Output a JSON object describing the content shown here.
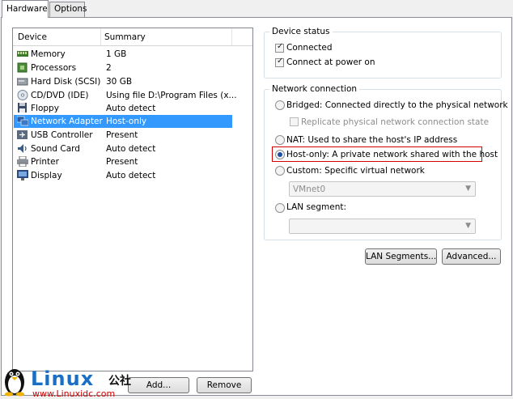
{
  "tabs": [
    {
      "label": "Hardware",
      "active": true
    },
    {
      "label": "Options",
      "active": false
    }
  ],
  "device_list": {
    "columns": [
      "Device",
      "Summary"
    ],
    "rows": [
      {
        "device": "Memory",
        "summary": "1 GB",
        "icon": "memory-icon"
      },
      {
        "device": "Processors",
        "summary": "2",
        "icon": "processor-icon"
      },
      {
        "device": "Hard Disk (SCSI)",
        "summary": "30 GB",
        "icon": "hard-disk-icon"
      },
      {
        "device": "CD/DVD (IDE)",
        "summary": "Using file D:\\Program Files (x...",
        "icon": "cd-dvd-icon"
      },
      {
        "device": "Floppy",
        "summary": "Auto detect",
        "icon": "floppy-icon"
      },
      {
        "device": "Network Adapter",
        "summary": "Host-only",
        "icon": "network-adapter-icon",
        "selected": true
      },
      {
        "device": "USB Controller",
        "summary": "Present",
        "icon": "usb-icon"
      },
      {
        "device": "Sound Card",
        "summary": "Auto detect",
        "icon": "sound-card-icon"
      },
      {
        "device": "Printer",
        "summary": "Present",
        "icon": "printer-icon"
      },
      {
        "device": "Display",
        "summary": "Auto detect",
        "icon": "display-icon"
      }
    ],
    "add_button": "Add...",
    "remove_button": "Remove"
  },
  "device_status": {
    "title": "Device status",
    "connected": {
      "label": "Connected",
      "checked": true
    },
    "connect_at_power_on": {
      "label": "Connect at power on",
      "checked": true
    }
  },
  "network_connection": {
    "title": "Network connection",
    "bridged": "Bridged: Connected directly to the physical network",
    "replicate": "Replicate physical network connection state",
    "nat": "NAT: Used to share the host's IP address",
    "host_only": "Host-only: A private network shared with the host",
    "custom": "Custom: Specific virtual network",
    "vmnet_value": "VMnet0",
    "lan_segment": "LAN segment:",
    "lan_segment_value": "",
    "selected": "host_only"
  },
  "buttons": {
    "lan_segments": "LAN Segments...",
    "advanced": "Advanced..."
  },
  "watermark": {
    "brand": "Linux",
    "brand_cn": "公社",
    "url": "www.Linuxidc.com"
  },
  "colors": {
    "selection": "#3399ff",
    "highlight_border": "#d40000",
    "radio_dot": "#1d4ea3"
  }
}
